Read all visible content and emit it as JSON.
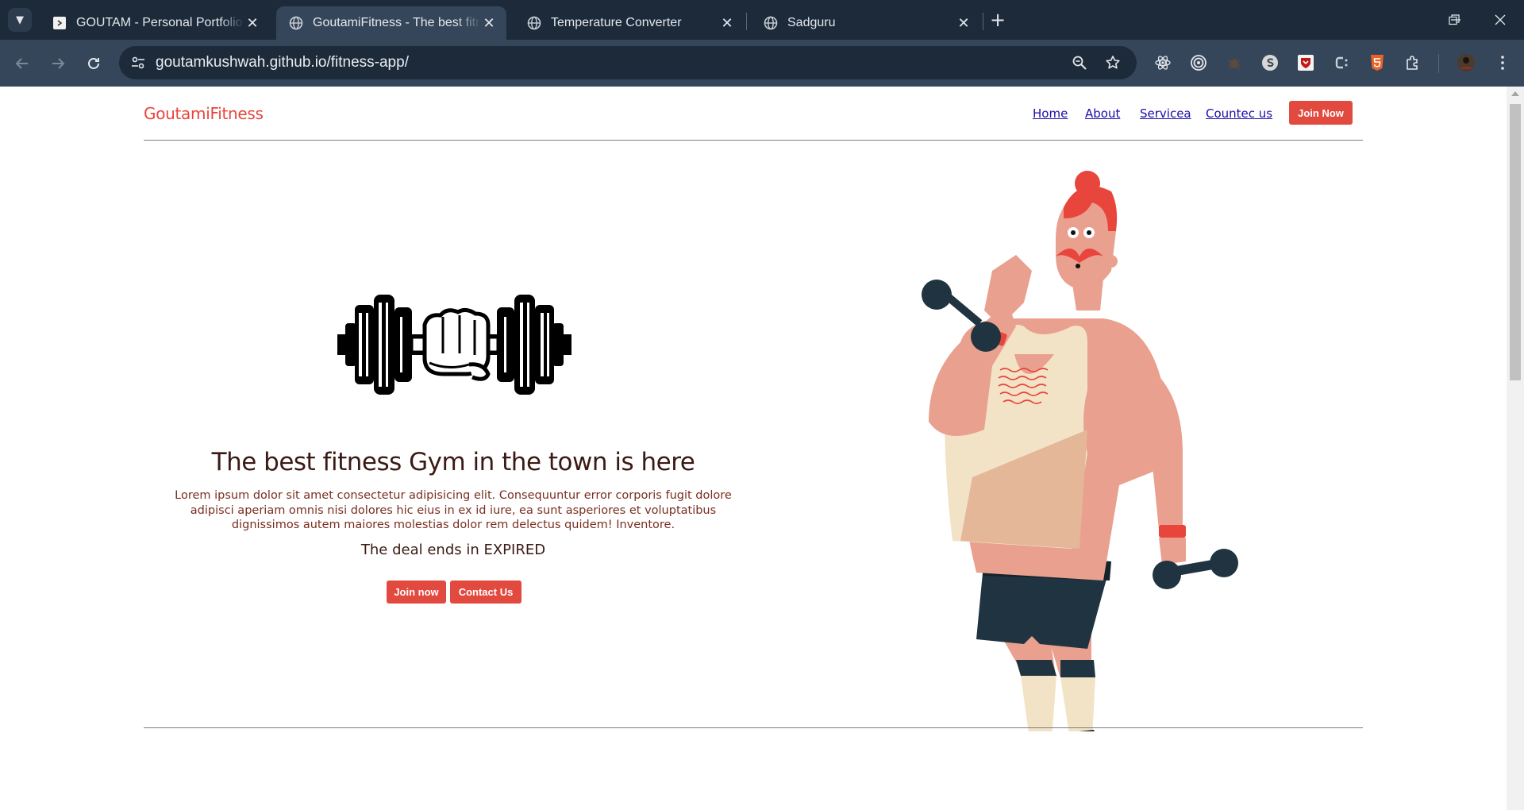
{
  "browser": {
    "tabs": [
      {
        "title": "GOUTAM - Personal Portfolio Template",
        "active": false
      },
      {
        "title": "GoutamiFitness - The best fitness Gym",
        "active": true
      },
      {
        "title": "Temperature Converter",
        "active": false
      },
      {
        "title": "Sadguru",
        "active": false
      }
    ],
    "url": "goutamkushwah.github.io/fitness-app/"
  },
  "site": {
    "brand": "GoutamiFitness",
    "nav": [
      "Home",
      "About",
      "Servicea",
      "Countec us"
    ],
    "join_top": "Join Now",
    "headline": "The best fitness Gym in the town is here",
    "lorem": "Lorem ipsum dolor sit amet consectetur adipisicing elit. Consequuntur error corporis fugit dolore adipisci aperiam omnis nisi dolores hic eius in ex id iure, ea sunt asperiores et voluptatibus dignissimos autem maiores molestias dolor rem delectus quidem! Inventore.",
    "deal": "The deal ends in EXPIRED",
    "join_now": "Join now",
    "contact_us": "Contact Us"
  },
  "colors": {
    "accent": "#e34a3f",
    "brand": "#e8453c",
    "chrome_dark": "#1c2a3a",
    "chrome_mid": "#36465a"
  },
  "icons": {
    "tab_menu": "chevron-down-icon",
    "portfolio_favicon": "portfolio-favicon",
    "globe": "globe-icon",
    "back": "back-arrow-icon",
    "forward": "forward-arrow-icon",
    "reload": "reload-icon",
    "site_info": "tune-icon",
    "zoom": "zoom-icon",
    "bookmark": "star-icon",
    "extensions": [
      "react-devtools-icon",
      "target-icon",
      "bug-icon",
      "s-icon",
      "mcafee-icon",
      "css-icon",
      "html5-icon",
      "puzzle-icon"
    ],
    "profile": "avatar",
    "menu": "kebab-menu-icon"
  }
}
